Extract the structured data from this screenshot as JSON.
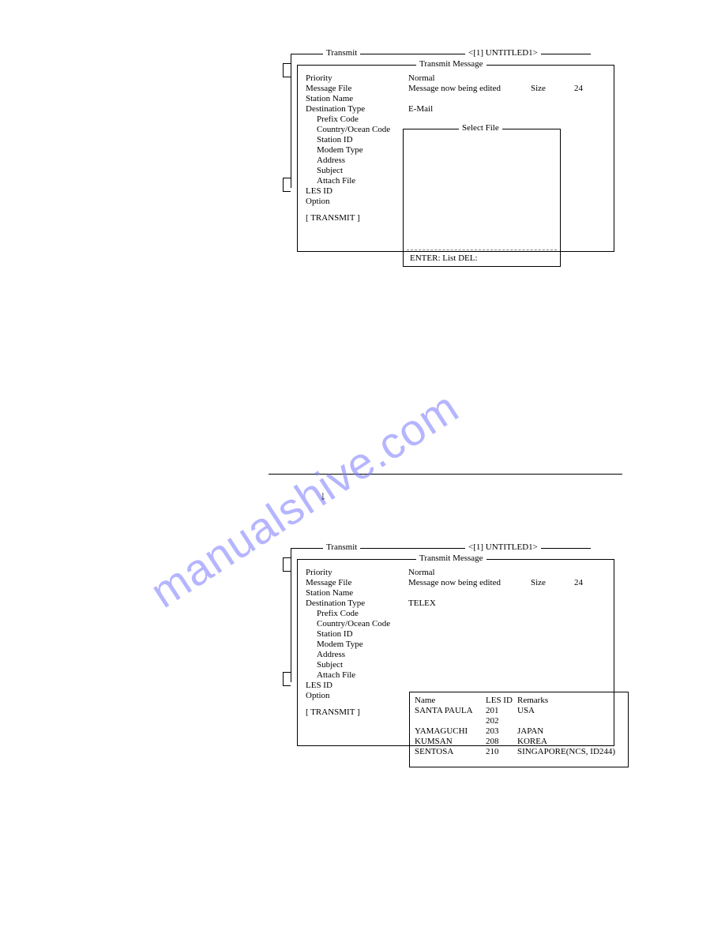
{
  "watermark": "manualshive.com",
  "panel1": {
    "outer_left_title": "Transmit",
    "outer_right_title": "<[1] UNTITLED1>",
    "inner_title": "Transmit Message",
    "fields": {
      "priority_label": "Priority",
      "priority_value": "Normal",
      "message_file_label": "Message File",
      "message_file_value": "Message now being edited",
      "size_label": "Size",
      "size_value": "24",
      "station_name_label": "Station Name",
      "destination_type_label": "Destination Type",
      "destination_type_value": "E-Mail",
      "prefix_code_label": "Prefix Code",
      "country_ocean_label": "Country/Ocean Code",
      "station_id_label": "Station ID",
      "modem_type_label": "Modem Type",
      "address_label": "Address",
      "subject_label": "Subject",
      "attach_file_label": "Attach File",
      "les_id_label": "LES ID",
      "option_label": "Option",
      "transmit_button": "[  TRANSMIT  ]"
    },
    "select_file": {
      "title": "Select File",
      "footer": "ENTER: List   DEL:"
    }
  },
  "panel2": {
    "outer_left_title": "Transmit",
    "outer_right_title": "<[1] UNTITLED1>",
    "inner_title": "Transmit Message",
    "fields": {
      "priority_label": "Priority",
      "priority_value": "Normal",
      "message_file_label": "Message File",
      "message_file_value": "Message now being edited",
      "size_label": "Size",
      "size_value": "24",
      "station_name_label": "Station Name",
      "destination_type_label": "Destination Type",
      "destination_type_value": "TELEX",
      "prefix_code_label": "Prefix Code",
      "country_ocean_label": "Country/Ocean Code",
      "station_id_label": "Station ID",
      "modem_type_label": "Modem Type",
      "address_label": "Address",
      "subject_label": "Subject",
      "attach_file_label": "Attach File",
      "les_id_label": "LES ID",
      "option_label": "Option",
      "transmit_button": "[  TRANSMIT  ]"
    },
    "les_table": {
      "headers": {
        "name": "Name",
        "les_id": "LES ID",
        "remarks": "Remarks"
      },
      "rows": [
        {
          "name": "SANTA PAULA",
          "les_id": "201",
          "remarks": "USA"
        },
        {
          "name": "",
          "les_id": "202",
          "remarks": ""
        },
        {
          "name": "YAMAGUCHI",
          "les_id": "203",
          "remarks": "JAPAN"
        },
        {
          "name": "KUMSAN",
          "les_id": "208",
          "remarks": "KOREA"
        },
        {
          "name": "SENTOSA",
          "les_id": "210",
          "remarks": "SINGAPORE(NCS, ID244)"
        }
      ]
    }
  }
}
